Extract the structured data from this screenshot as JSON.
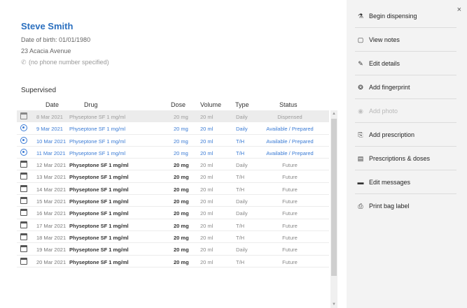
{
  "patient": {
    "name": "Steve Smith",
    "dob": "Date of birth: 01/01/1980",
    "address": "23 Acacia Avenue",
    "phone": "(no phone number specified)"
  },
  "section_title": "Supervised",
  "table": {
    "headers": {
      "date": "Date",
      "drug": "Drug",
      "dose": "Dose",
      "volume": "Volume",
      "type": "Type",
      "status": "Status"
    },
    "rows": [
      {
        "date": "8 Mar 2021",
        "drug": "Physeptone SF 1 mg/ml",
        "dose": "20 mg",
        "volume": "20 ml",
        "type": "Daily",
        "status": "Dispensed",
        "icon": "calendar-icon",
        "state": "past"
      },
      {
        "date": "9 Mar 2021",
        "drug": "Physeptone SF 1 mg/ml",
        "dose": "20 mg",
        "volume": "20 ml",
        "type": "Daily",
        "status": "Available / Prepared",
        "icon": "available-icon",
        "state": "avail"
      },
      {
        "date": "10 Mar 2021",
        "drug": "Physeptone SF 1 mg/ml",
        "dose": "20 mg",
        "volume": "20 ml",
        "type": "T/H",
        "status": "Available / Prepared",
        "icon": "available-icon",
        "state": "avail"
      },
      {
        "date": "11 Mar 2021",
        "drug": "Physeptone SF 1 mg/ml",
        "dose": "20 mg",
        "volume": "20 ml",
        "type": "T/H",
        "status": "Available / Prepared",
        "icon": "available-icon",
        "state": "avail"
      },
      {
        "date": "12 Mar 2021",
        "drug": "Physeptone SF 1 mg/ml",
        "dose": "20 mg",
        "volume": "20 ml",
        "type": "Daily",
        "status": "Future",
        "icon": "calendar-icon",
        "state": "future"
      },
      {
        "date": "13 Mar 2021",
        "drug": "Physeptone SF 1 mg/ml",
        "dose": "20 mg",
        "volume": "20 ml",
        "type": "T/H",
        "status": "Future",
        "icon": "calendar-icon",
        "state": "future"
      },
      {
        "date": "14 Mar 2021",
        "drug": "Physeptone SF 1 mg/ml",
        "dose": "20 mg",
        "volume": "20 ml",
        "type": "T/H",
        "status": "Future",
        "icon": "calendar-icon",
        "state": "future"
      },
      {
        "date": "15 Mar 2021",
        "drug": "Physeptone SF 1 mg/ml",
        "dose": "20 mg",
        "volume": "20 ml",
        "type": "Daily",
        "status": "Future",
        "icon": "calendar-icon",
        "state": "future"
      },
      {
        "date": "16 Mar 2021",
        "drug": "Physeptone SF 1 mg/ml",
        "dose": "20 mg",
        "volume": "20 ml",
        "type": "Daily",
        "status": "Future",
        "icon": "calendar-icon",
        "state": "future"
      },
      {
        "date": "17 Mar 2021",
        "drug": "Physeptone SF 1 mg/ml",
        "dose": "20 mg",
        "volume": "20 ml",
        "type": "T/H",
        "status": "Future",
        "icon": "calendar-icon",
        "state": "future"
      },
      {
        "date": "18 Mar 2021",
        "drug": "Physeptone SF 1 mg/ml",
        "dose": "20 mg",
        "volume": "20 ml",
        "type": "T/H",
        "status": "Future",
        "icon": "calendar-icon",
        "state": "future"
      },
      {
        "date": "19 Mar 2021",
        "drug": "Physeptone SF 1 mg/ml",
        "dose": "20 mg",
        "volume": "20 ml",
        "type": "Daily",
        "status": "Future",
        "icon": "calendar-icon",
        "state": "future"
      },
      {
        "date": "20 Mar 2021",
        "drug": "Physeptone SF 1 mg/ml",
        "dose": "20 mg",
        "volume": "20 ml",
        "type": "T/H",
        "status": "Future",
        "icon": "calendar-icon",
        "state": "future"
      }
    ]
  },
  "sidebar": {
    "close_label": "×",
    "actions": [
      {
        "label": "Begin dispensing",
        "icon": "pestle-icon",
        "glyph": "⚗",
        "enabled": true
      },
      {
        "label": "View notes",
        "icon": "notes-icon",
        "glyph": "▢",
        "enabled": true
      },
      {
        "label": "Edit details",
        "icon": "pencil-icon",
        "glyph": "✎",
        "enabled": true
      },
      {
        "label": "Add fingerprint",
        "icon": "fingerprint-icon",
        "glyph": "❂",
        "enabled": true
      },
      {
        "label": "Add photo",
        "icon": "camera-icon",
        "glyph": "◉",
        "enabled": false
      },
      {
        "label": "Add prescription",
        "icon": "prescription-icon",
        "glyph": "⎘",
        "enabled": true
      },
      {
        "label": "Prescriptions & doses",
        "icon": "list-icon",
        "glyph": "▤",
        "enabled": true
      },
      {
        "label": "Edit messages",
        "icon": "message-icon",
        "glyph": "▬",
        "enabled": true
      },
      {
        "label": "Print bag label",
        "icon": "printer-icon",
        "glyph": "⎙",
        "enabled": true
      }
    ]
  }
}
